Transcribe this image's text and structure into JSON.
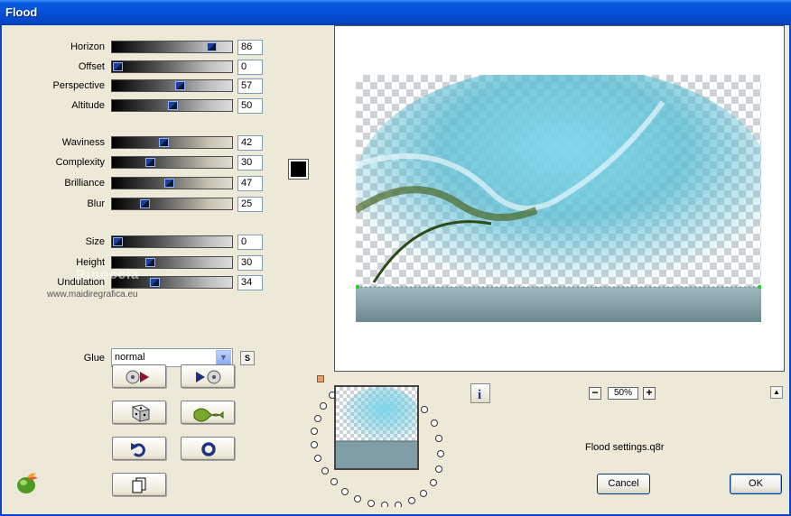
{
  "window": {
    "title": "Flood"
  },
  "params_top": [
    {
      "label": "Horizon",
      "value": "86",
      "fraction": 0.86
    },
    {
      "label": "Offset",
      "value": "0",
      "fraction": 0.0
    },
    {
      "label": "Perspective",
      "value": "57",
      "fraction": 0.57
    },
    {
      "label": "Altitude",
      "value": "50",
      "fraction": 0.5
    }
  ],
  "params_mid": [
    {
      "label": "Waviness",
      "value": "42",
      "fraction": 0.42
    },
    {
      "label": "Complexity",
      "value": "30",
      "fraction": 0.3
    },
    {
      "label": "Brilliance",
      "value": "47",
      "fraction": 0.47
    },
    {
      "label": "Blur",
      "value": "25",
      "fraction": 0.25
    }
  ],
  "params_bottom": [
    {
      "label": "Size",
      "value": "0",
      "fraction": 0.0
    },
    {
      "label": "Height",
      "value": "30",
      "fraction": 0.3
    },
    {
      "label": "Undulation",
      "value": "34",
      "fraction": 0.34
    }
  ],
  "color_swatch": "#000000",
  "glue": {
    "label": "Glue",
    "selected": "normal",
    "save_label": "S"
  },
  "watermark": {
    "line1": "Rinoccia",
    "line2": "www.maidiregrafica.eu"
  },
  "icons": {
    "tool_buttons": [
      "cd-back-icon",
      "cd-forward-icon",
      "dice-icon",
      "wave-icon",
      "undo-icon",
      "reset-icon",
      "copy-icon"
    ],
    "info": "info-icon",
    "logo": "plugin-logo-icon"
  },
  "zoom": {
    "minus": "−",
    "level": "50%",
    "plus": "+"
  },
  "scroll_up": "▲",
  "info_label": "i",
  "settings_file": "Flood settings.q8r",
  "buttons": {
    "cancel": "Cancel",
    "ok": "OK"
  }
}
